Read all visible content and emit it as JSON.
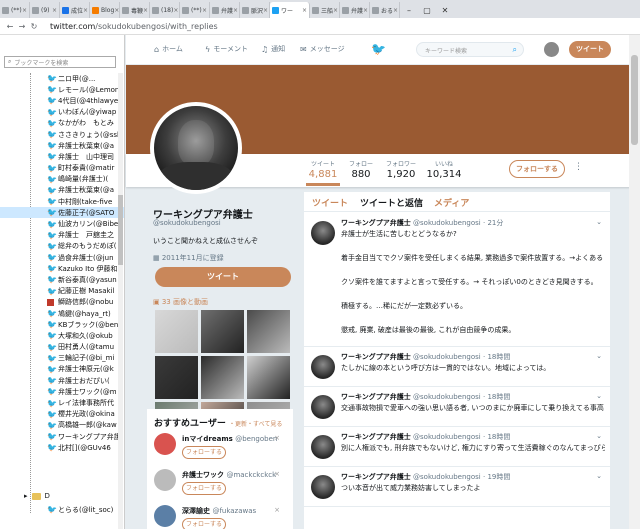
{
  "browser": {
    "tabs": [
      {
        "label": "(**)",
        "color": "#9aa0a6"
      },
      {
        "label": "(9)",
        "color": "#9aa0a6"
      },
      {
        "label": "成位",
        "color": "#1a73e8"
      },
      {
        "label": "Blog",
        "color": "#f57c00"
      },
      {
        "label": "毒鞭",
        "color": "#9aa0a6"
      },
      {
        "label": "(18)",
        "color": "#9aa0a6"
      },
      {
        "label": "(**)",
        "color": "#9aa0a6"
      },
      {
        "label": "弁護",
        "color": "#9aa0a6"
      },
      {
        "label": "脈沢",
        "color": "#9aa0a6"
      },
      {
        "label": "ワー",
        "color": "#1da1f2"
      },
      {
        "label": "三船",
        "color": "#9aa0a6"
      },
      {
        "label": "弁護",
        "color": "#9aa0a6"
      },
      {
        "label": "おる",
        "color": "#9aa0a6"
      }
    ],
    "url_host": "twitter.com",
    "url_path": "/sokudokubengosi/with_replies"
  },
  "sidebar": {
    "search_placeholder": "ブックマークを検索",
    "items": [
      {
        "label": "二ロ甲(@...",
        "type": "bird"
      },
      {
        "label": "レモール(@Lemon",
        "type": "bird"
      },
      {
        "label": "4代目(@4thlawye",
        "type": "bird"
      },
      {
        "label": "いわぼん(@yiwap",
        "type": "bird"
      },
      {
        "label": "なかがわ　もとみ",
        "type": "bird"
      },
      {
        "label": "ささきりょう(@ssk",
        "type": "bird"
      },
      {
        "label": "弁護士秋葉束(@a",
        "type": "bird"
      },
      {
        "label": "弁護士　山中理司",
        "type": "bird"
      },
      {
        "label": "町村泰貴(@matir",
        "type": "bird"
      },
      {
        "label": "嶋崎量(弁護士)(",
        "type": "bird"
      },
      {
        "label": "弁護士秋葉束(@a",
        "type": "bird"
      },
      {
        "label": "中村剛(take-five",
        "type": "bird"
      },
      {
        "label": "佐藤正子(@SATO",
        "type": "bird",
        "selected": true
      },
      {
        "label": "仙波カリン(@Bibe",
        "type": "bird"
      },
      {
        "label": "弁護士　戸舘圭之",
        "type": "bird"
      },
      {
        "label": "総弁のもうだめぽ(",
        "type": "bird"
      },
      {
        "label": "過食弁護士(@jun",
        "type": "bird"
      },
      {
        "label": "Kazuko Ito 伊藤和",
        "type": "bird"
      },
      {
        "label": "新谷泰真(@yasun",
        "type": "bird"
      },
      {
        "label": "紀藤正樹 Masakil",
        "type": "bird"
      },
      {
        "label": "鰤跡信郎(@nobu",
        "type": "square",
        "color": "#c0392b"
      },
      {
        "label": "鳩鍵(@haya_rt)",
        "type": "bird"
      },
      {
        "label": "KBブラック(@ben",
        "type": "bird"
      },
      {
        "label": "大塚和久(@okub",
        "type": "bird"
      },
      {
        "label": "田村勇人(@tamu",
        "type": "bird"
      },
      {
        "label": "三輪記子(@bi_mi",
        "type": "bird"
      },
      {
        "label": "弁護士神原元(@k",
        "type": "bird"
      },
      {
        "label": "弁護士おだぴい(",
        "type": "bird"
      },
      {
        "label": "弁護士ワック(@m",
        "type": "bird"
      },
      {
        "label": "レイ法律事務所代",
        "type": "bird"
      },
      {
        "label": "櫻井光政(@okina",
        "type": "bird"
      },
      {
        "label": "高橋雄一郎(@kaw",
        "type": "bird"
      },
      {
        "label": "ワーキングプア弁護",
        "type": "bird"
      },
      {
        "label": "北村[](@GUv46",
        "type": "bird"
      }
    ],
    "folder_label": "D",
    "last_item": "とらる(@lit_soc)"
  },
  "twitter": {
    "nav": {
      "home": "ホーム",
      "moments": "モーメント",
      "notifications": "通知",
      "messages": "メッセージ"
    },
    "search_placeholder": "キーワード検索",
    "tweet_button": "ツイート",
    "accent": "#c9875a",
    "banner_color": "#9a5a32"
  },
  "stats": [
    {
      "label": "ツイート",
      "value": "4,881"
    },
    {
      "label": "フォロー",
      "value": "880"
    },
    {
      "label": "フォロワー",
      "value": "1,920"
    },
    {
      "label": "いいね",
      "value": "10,314"
    }
  ],
  "follow_button": "フォローする",
  "profile": {
    "name": "ワーキングプア弁護士",
    "handle": "@sokudokubengosi",
    "bio": "いうこと聞かねえと成仏させんぞ",
    "joined": "2011年11月に登録",
    "tweet_button": "ツイート",
    "media_label": "33 画像と動画"
  },
  "media_colors": [
    "#d8d8d8",
    "#6f6f6f",
    "#4a4a4a",
    "#3a3a3a",
    "#2b2b2b",
    "#cfcfcf",
    "#6a7a6e",
    "#c2a89a",
    "#8e8e8e"
  ],
  "who_to_follow": {
    "title": "おすすめユーザー",
    "links": "・更新・すべて見る",
    "users": [
      {
        "name": "inマイdreams",
        "handle": "@bengoben",
        "button": "フォローする",
        "color": "#d9534f"
      },
      {
        "name": "弁護士ワック",
        "handle": "@mackckckck",
        "button": "フォローする",
        "color": "#bbbbbb"
      },
      {
        "name": "深澤諭史",
        "handle": "@fukazawas",
        "button": "フォローする",
        "color": "#5b7fa6"
      }
    ]
  },
  "timeline": {
    "tabs": [
      "ツイート",
      "ツイートと返信",
      "メディア"
    ],
    "tweets": [
      {
        "name": "ワーキングプア弁護士",
        "handle": "@sokudokubengosi",
        "time": "21分",
        "lines": [
          "弁護士が生活に苦しむとどうなるか?",
          "",
          "着手金目当てでクソ案件を受任しまくる結果, 業務過多で案件放置する。→よくある",
          "",
          "クソ案件を誰てますよと言って受任する。→ それっぽい0のときどき見聞きする。",
          "",
          "積極する。…稀にだが一定数必ずいる。",
          "",
          "懲戒, 廃業, 破産は最後の最後, これが自由競争の成果。"
        ]
      },
      {
        "name": "ワーキングプア弁護士",
        "handle": "@sokudokubengosi",
        "time": "18時間",
        "lines": [
          "たしかに線の本という呼び方は一貫的ではない。地域によっては。"
        ]
      },
      {
        "name": "ワーキングプア弁護士",
        "handle": "@sokudokubengosi",
        "time": "18時間",
        "lines": [
          "交通事故物損で愛車への強い思い語る者, いつのまにか廃車にして乗り換えてる事高し。"
        ]
      },
      {
        "name": "ワーキングプア弁護士",
        "handle": "@sokudokubengosi",
        "time": "18時間",
        "lines": [
          "別に人権派でも, 刑弁族でもないけど, 権力にすり寄って生活費稼ぐのなんてまっぴらごめん。それやるくらいなら, 書物から会社員か(ry"
        ]
      },
      {
        "name": "ワーキングプア弁護士",
        "handle": "@sokudokubengosi",
        "time": "19時間",
        "lines": [
          "つい本音が出て威力業務妨害してしまったよ"
        ]
      }
    ]
  }
}
